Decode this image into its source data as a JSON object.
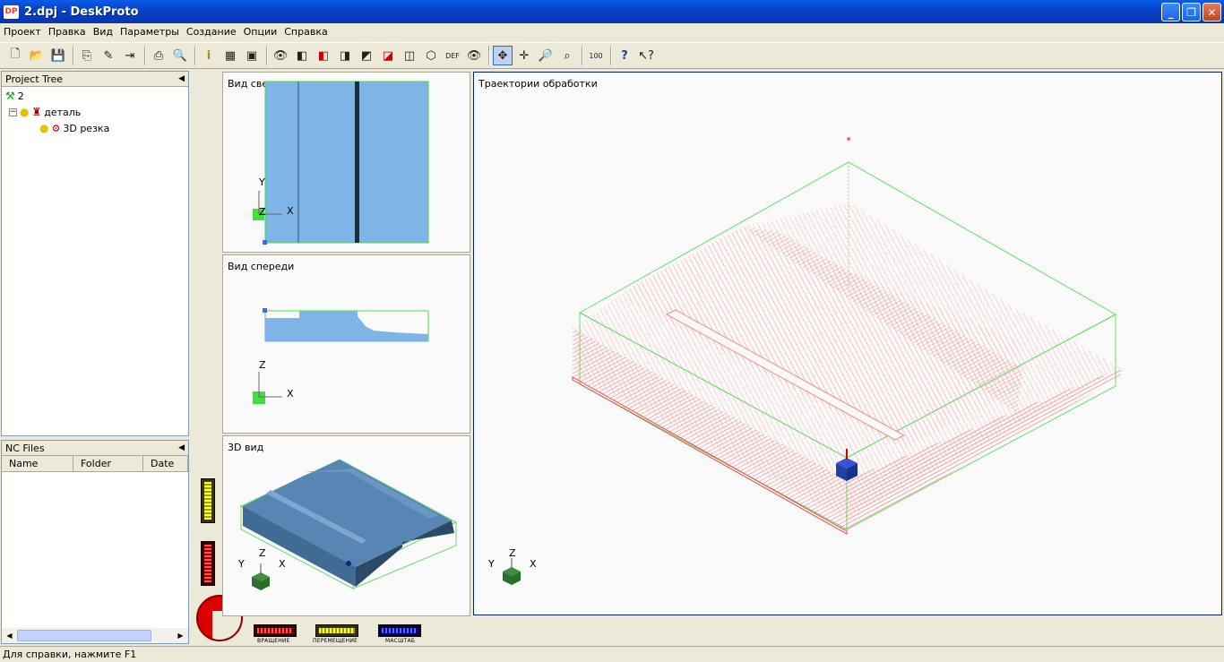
{
  "window": {
    "title": "2.dpj - DeskProto",
    "icon_text": "DP"
  },
  "menu": [
    "Проект",
    "Правка",
    "Вид",
    "Параметры",
    "Создание",
    "Опции",
    "Справка"
  ],
  "project_tree": {
    "header": "Project Tree",
    "root": "2",
    "part": "деталь",
    "operation": "3D резка"
  },
  "nc_files": {
    "header": "NC Files",
    "columns": [
      "Name",
      "Folder",
      "Date"
    ]
  },
  "views": {
    "top": "Вид сверху",
    "front": "Вид спереди",
    "iso": "3D вид",
    "toolpath": "Траектории обработки"
  },
  "axes": {
    "x": "X",
    "y": "Y",
    "z": "Z"
  },
  "controls": {
    "rotate": "ВРАЩЕНИЕ",
    "pan": "ПЕРЕМЕЩЕНИЕ",
    "zoom": "МАСШТАБ"
  },
  "status": "Для справки, нажмите F1"
}
